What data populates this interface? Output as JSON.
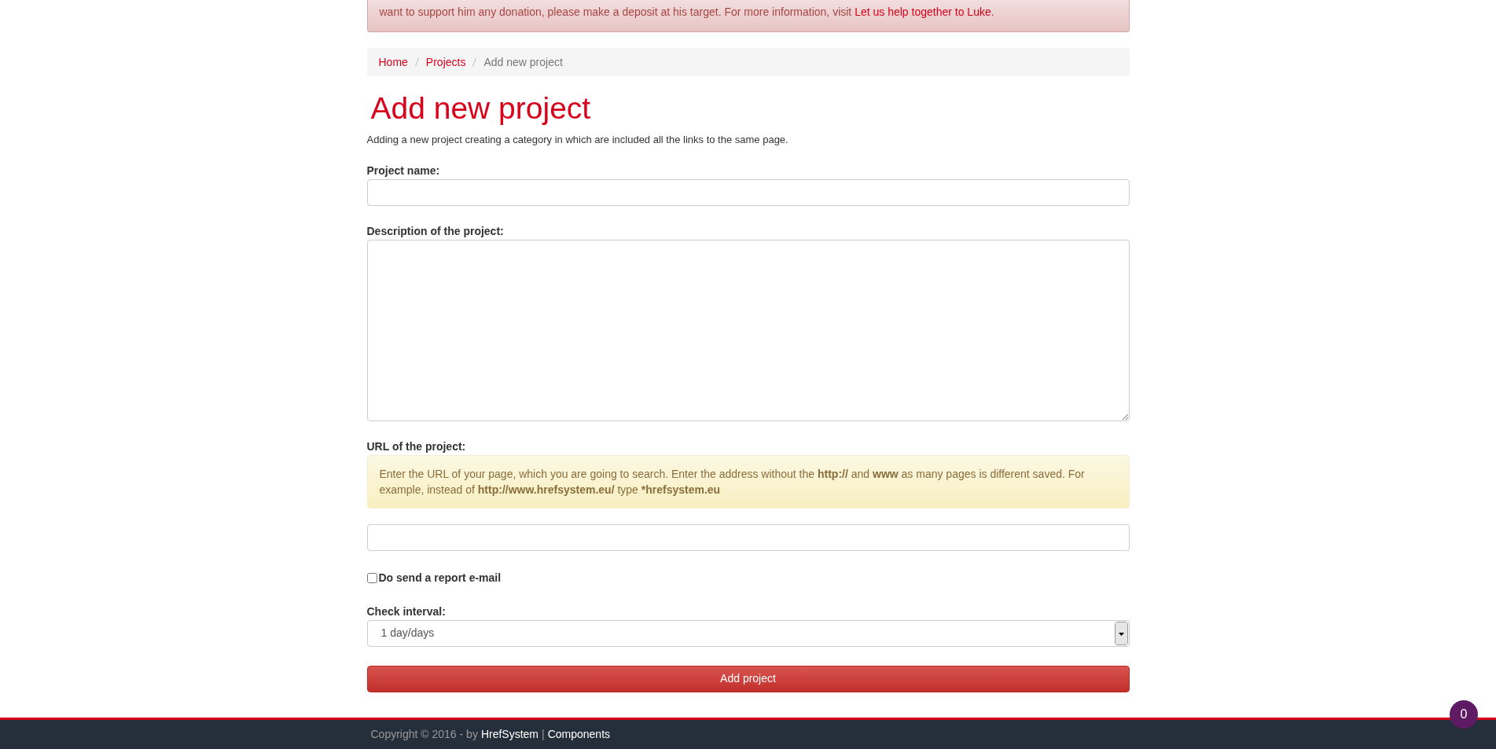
{
  "notice": {
    "text": "want to support him any donation, please make a deposit at his target. For more information, visit ",
    "link": "Let us help together to Luke",
    "end": "."
  },
  "breadcrumb": [
    {
      "label": "Home",
      "current": false
    },
    {
      "label": "Projects",
      "current": false
    },
    {
      "label": "Add new project",
      "current": true
    }
  ],
  "title": "Add new project",
  "intro": "Adding a new project creating a category in which are included all the links to the same page.",
  "fields": [
    {
      "kind": "input",
      "label": "Project name:"
    },
    {
      "kind": "textarea",
      "label": "Description of the project:"
    },
    {
      "kind": "input",
      "label": "URL of the project:",
      "hint": "Enter the URL of your page, which you are going to search. Enter the address without the **http://** and **www** as many pages is different saved. For example, instead of **http://www.hrefsystem.eu/** type ***hrefsystem.eu**"
    },
    {
      "kind": "checkbox",
      "label": "Do send a report e-mail",
      "checked": false
    },
    {
      "kind": "select",
      "label": "Check interval:",
      "value": "1 day/days"
    }
  ],
  "submit": "Add project",
  "footer": {
    "copyright": "Copyright © 2016 - by",
    "links": [
      "HrefSystem",
      "Components"
    ],
    "separator": "|"
  },
  "badge": "0"
}
